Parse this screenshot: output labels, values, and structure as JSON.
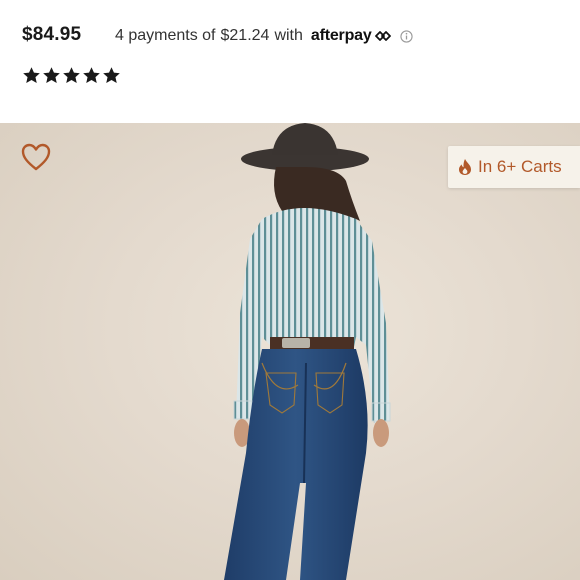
{
  "product": {
    "price": "$84.95",
    "installments_prefix": "4 payments of",
    "installment_amount": "$21.24",
    "installments_with": "with",
    "afterpay_brand": "afterpay",
    "rating_stars": 5
  },
  "image_overlay": {
    "wishlist_icon": "heart-outline-icon",
    "carts_badge_text": "In 6+ Carts",
    "carts_badge_icon": "flame-icon"
  },
  "colors": {
    "accent": "#b2592a",
    "badge_bg": "#f6f2ea",
    "star": "#1a1a1a"
  }
}
